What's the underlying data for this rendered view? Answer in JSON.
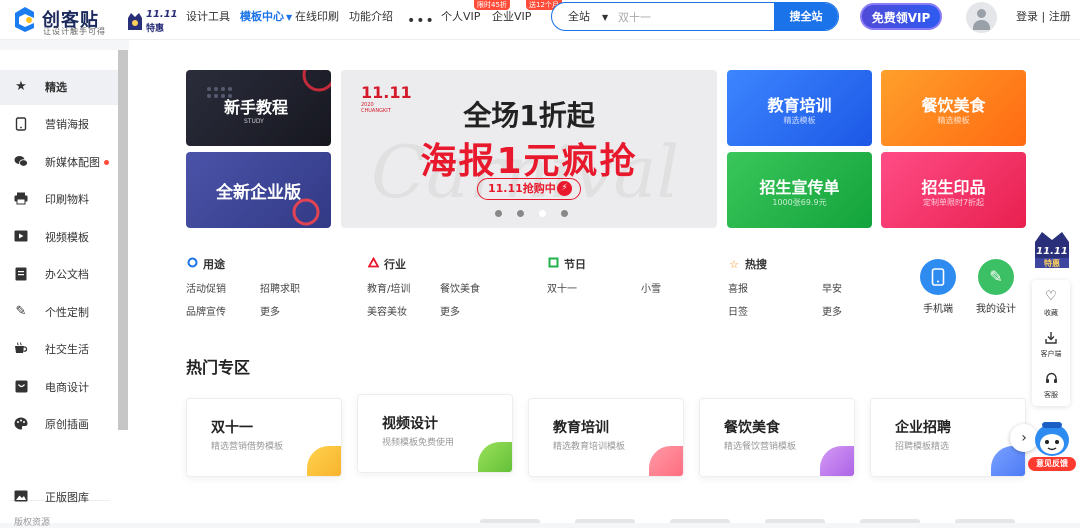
{
  "header": {
    "logo_text": "创客贴",
    "logo_slogan": "让设计触手可得",
    "badge_line1": "11.11",
    "badge_line2": "特惠",
    "nav": [
      {
        "label": "设计工具"
      },
      {
        "label": "模板中心"
      },
      {
        "label": "在线印刷"
      },
      {
        "label": "功能介绍"
      },
      {
        "label": "个人VIP"
      },
      {
        "label": "企业VIP"
      }
    ],
    "more": "•••",
    "sale_tag_1": "限时45折",
    "sale_tag_2": "送12个月",
    "search_scope": "全站",
    "search_placeholder": "双十一",
    "search_button": "搜全站",
    "vip_button": "免费领VIP",
    "login": "登录 | 注册"
  },
  "sidebar": {
    "items": [
      {
        "label": "精选",
        "icon": "star-icon"
      },
      {
        "label": "营销海报",
        "icon": "phone-icon"
      },
      {
        "label": "新媒体配图",
        "icon": "wechat-icon"
      },
      {
        "label": "印刷物料",
        "icon": "printer-icon"
      },
      {
        "label": "视频模板",
        "icon": "video-icon"
      },
      {
        "label": "办公文档",
        "icon": "document-icon"
      },
      {
        "label": "个性定制",
        "icon": "pen-icon"
      },
      {
        "label": "社交生活",
        "icon": "cup-icon"
      },
      {
        "label": "电商设计",
        "icon": "shop-icon"
      },
      {
        "label": "原创插画",
        "icon": "palette-icon"
      },
      {
        "label": "正版图库",
        "icon": "image-icon"
      }
    ],
    "section_label": "版权资源"
  },
  "banners": {
    "left_top": {
      "title": "新手教程",
      "sub": "STUDY"
    },
    "left_bottom": {
      "title": "全新企业版"
    },
    "center": {
      "mark_line1": "11.11",
      "mark_line2": "2020 CHUANGKIT",
      "line1": "全场1折起",
      "line2": "海报1元疯抢",
      "pill": "11.11抢购中",
      "bg_word": "Carnival"
    },
    "right": [
      {
        "title": "教育培训",
        "sub": "精选模板",
        "color": "#2e6ff0"
      },
      {
        "title": "餐饮美食",
        "sub": "精选模板",
        "color": "#ff7a18"
      },
      {
        "title": "招生宣传单",
        "sub": "1000张69.9元",
        "color": "#22b14c"
      },
      {
        "title": "招生印品",
        "sub": "定制单限时7折起",
        "color": "#f0306a"
      }
    ]
  },
  "categories": [
    {
      "title": "用途",
      "links": [
        "活动促销",
        "招聘求职",
        "品牌宣传",
        "更多"
      ]
    },
    {
      "title": "行业",
      "links": [
        "教育/培训",
        "餐饮美食",
        "美容美妆",
        "更多"
      ]
    },
    {
      "title": "节日",
      "links": [
        "双十一",
        "小雪"
      ]
    },
    {
      "title": "热搜",
      "links": [
        "喜报",
        "早安",
        "日签",
        "更多"
      ]
    }
  ],
  "quick": [
    {
      "label": "手机端",
      "color": "#2e8cf0"
    },
    {
      "label": "我的设计",
      "color": "#3cc065"
    }
  ],
  "hot": {
    "title": "热门专区",
    "zones": [
      {
        "title": "双十一",
        "sub": "精选营销借势模板",
        "color": "#f7c032"
      },
      {
        "title": "视频设计",
        "sub": "视频模板免费使用",
        "color": "#7ac943"
      },
      {
        "title": "教育培训",
        "sub": "精选教育培训模板",
        "color": "#ff7b8a"
      },
      {
        "title": "餐饮美食",
        "sub": "精选餐饮营销模板",
        "color": "#b86ee8"
      },
      {
        "title": "企业招聘",
        "sub": "招聘模板精选",
        "color": "#4d7ef7"
      }
    ]
  },
  "floatbar": {
    "badge_line1": "11.11",
    "badge_line2": "特惠",
    "items": [
      {
        "label": "收藏",
        "icon": "heart-icon"
      },
      {
        "label": "客户端",
        "icon": "download-icon"
      },
      {
        "label": "客服",
        "icon": "headset-icon"
      }
    ],
    "feedback": "意见反馈"
  }
}
